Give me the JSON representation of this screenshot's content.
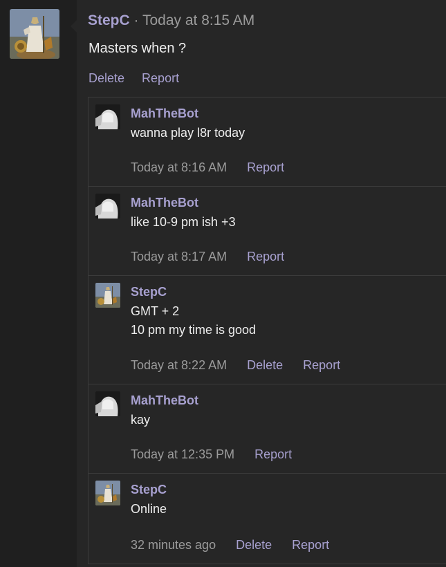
{
  "post": {
    "author": "StepC",
    "separator": "·",
    "time": "Today at 8:15 AM",
    "body": "Masters when ?",
    "actions": {
      "delete": "Delete",
      "report": "Report"
    }
  },
  "replies": [
    {
      "author": "MahTheBot",
      "avatar": "pale-figure-avatar",
      "lines": [
        "wanna play l8r today"
      ],
      "time": "Today at 8:16 AM",
      "actions": {
        "report": "Report"
      }
    },
    {
      "author": "MahTheBot",
      "avatar": "pale-figure-avatar",
      "lines": [
        "like 10-9 pm ish +3"
      ],
      "time": "Today at 8:17 AM",
      "actions": {
        "report": "Report"
      }
    },
    {
      "author": "StepC",
      "avatar": "athena-statue-avatar",
      "lines": [
        "GMT + 2",
        "10 pm my time is good"
      ],
      "time": "Today at 8:22 AM",
      "actions": {
        "delete": "Delete",
        "report": "Report"
      }
    },
    {
      "author": "MahTheBot",
      "avatar": "pale-figure-avatar",
      "lines": [
        "kay"
      ],
      "time": "Today at 12:35 PM",
      "actions": {
        "report": "Report"
      }
    },
    {
      "author": "StepC",
      "avatar": "athena-statue-avatar",
      "lines": [
        "Online"
      ],
      "time": "32 minutes ago",
      "actions": {
        "delete": "Delete",
        "report": "Report"
      }
    }
  ],
  "colors": {
    "page_bg": "#1f1f1f",
    "panel_bg": "#262626",
    "accent": "#a7a0cf",
    "text": "#ededed",
    "muted": "#9b9b9b",
    "border": "#3b3b3b"
  }
}
